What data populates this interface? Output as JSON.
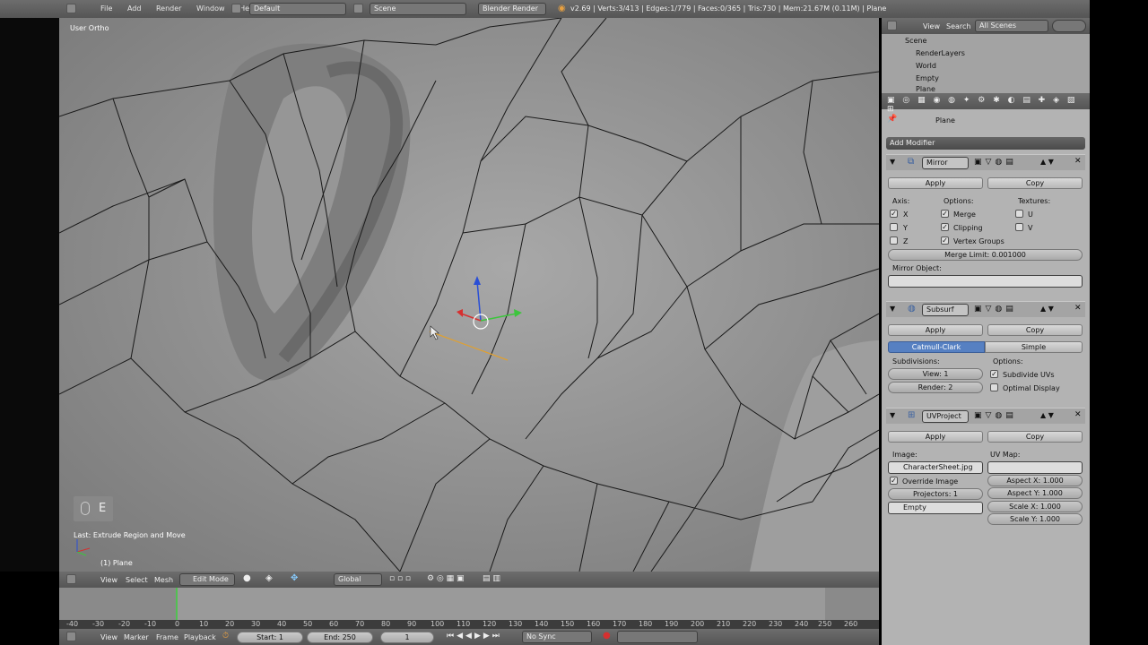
{
  "top_bar": {
    "menus": [
      "File",
      "Add",
      "Render",
      "Window",
      "Help"
    ],
    "layout": "Default",
    "scene": "Scene",
    "engine": "Blender Render",
    "stats": "v2.69 | Verts:3/413 | Edges:1/779 | Faces:0/365 | Tris:730 | Mem:21.67M (0.11M) | Plane"
  },
  "viewport": {
    "view_label": "User Ortho",
    "key_display": "E",
    "last_op": "Last: Extrude Region and Move",
    "object_label": "(1) Plane"
  },
  "view_header": {
    "menus": [
      "View",
      "Select",
      "Mesh"
    ],
    "mode": "Edit Mode",
    "orientation": "Global"
  },
  "outliner": {
    "menus": [
      "View",
      "Search"
    ],
    "filter": "All Scenes",
    "items": [
      "Scene",
      "RenderLayers",
      "World",
      "Empty",
      "Plane"
    ]
  },
  "properties": {
    "object_name": "Plane",
    "add_modifier": "Add Modifier",
    "mirror": {
      "name": "Mirror",
      "apply": "Apply",
      "copy": "Copy",
      "axis_label": "Axis:",
      "options_label": "Options:",
      "textures_label": "Textures:",
      "axes": [
        "X",
        "Y",
        "Z"
      ],
      "options": [
        "Merge",
        "Clipping",
        "Vertex Groups"
      ],
      "textures": [
        "U",
        "V"
      ],
      "merge_limit": "Merge Limit: 0.001000",
      "mirror_object_label": "Mirror Object:"
    },
    "subsurf": {
      "name": "Subsurf",
      "apply": "Apply",
      "copy": "Copy",
      "type_active": "Catmull-Clark",
      "type_other": "Simple",
      "subdivisions_label": "Subdivisions:",
      "options_label": "Options:",
      "view": "View: 1",
      "render": "Render: 2",
      "subdivide_uvs": "Subdivide UVs",
      "optimal_display": "Optimal Display"
    },
    "uvproject": {
      "name": "UVProject",
      "apply": "Apply",
      "copy": "Copy",
      "image_label": "Image:",
      "uvmap_label": "UV Map:",
      "image": "CharacterSheet.jpg",
      "override_image": "Override Image",
      "projectors": "Projectors: 1",
      "projector_object": "Empty",
      "aspect_x": "Aspect X: 1.000",
      "aspect_y": "Aspect Y: 1.000",
      "scale_x": "Scale X: 1.000",
      "scale_y": "Scale Y: 1.000"
    }
  },
  "timeline": {
    "ticks": [
      "-40",
      "-30",
      "-20",
      "-10",
      "0",
      "10",
      "20",
      "30",
      "40",
      "50",
      "60",
      "70",
      "80",
      "90",
      "100",
      "110",
      "120",
      "130",
      "140",
      "150",
      "160",
      "170",
      "180",
      "190",
      "200",
      "210",
      "220",
      "230",
      "240",
      "250",
      "260"
    ],
    "menus": [
      "View",
      "Marker",
      "Frame",
      "Playback"
    ],
    "start": "Start: 1",
    "end": "End: 250",
    "current": "1",
    "sync": "No Sync"
  },
  "colors": {
    "accent_blue": "#5680c2",
    "viewport_bg": "#8f8f8f",
    "panel_bg": "#b5b5b5"
  }
}
